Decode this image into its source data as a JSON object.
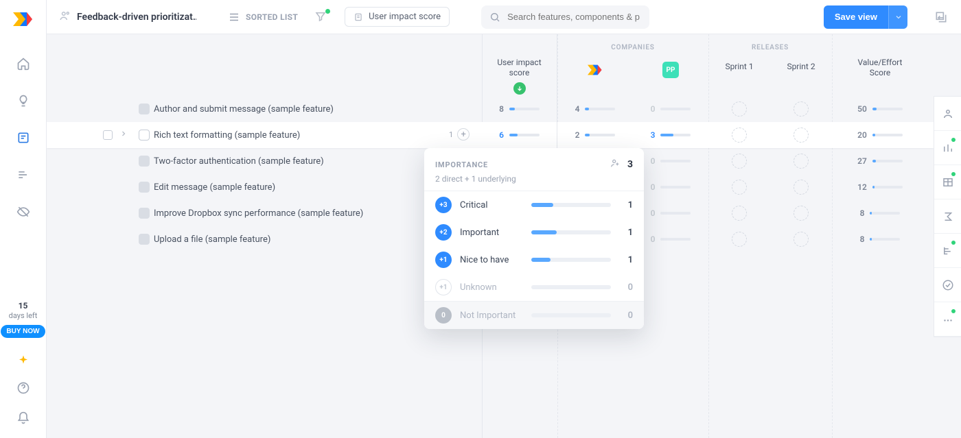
{
  "header": {
    "document_title": "Feedback-driven prioritizat…",
    "sorted_label": "SORTED LIST",
    "chip_label": "User impact score",
    "search_placeholder": "Search features, components & products…",
    "save_label": "Save view"
  },
  "trial": {
    "days": "15",
    "days_label": "days left",
    "buy_label": "BUY NOW"
  },
  "columns": {
    "user_impact": "User impact\nscore",
    "group_companies": "COMPANIES",
    "group_releases": "RELEASES",
    "release1": "Sprint 1",
    "release2": "Sprint 2",
    "value_effort": "Value/Effort\nScore",
    "company2_badge": "PP"
  },
  "rows": [
    {
      "name": "Author and submit message (sample feature)",
      "uis": "8",
      "uis_pct": 18,
      "c1": "4",
      "c1_pct": 12,
      "c2": "0",
      "c2_pct": 0,
      "ve": "50",
      "ve_pct": 14
    },
    {
      "name": "Rich text formatting (sample feature)",
      "hover": true,
      "count": "1",
      "uis": "6",
      "uis_pct": 28,
      "uis_blue": true,
      "c1": "2",
      "c1_pct": 16,
      "c2": "3",
      "c2_pct": 42,
      "ve": "20",
      "ve_pct": 10
    },
    {
      "name": "Two-factor authentication (sample feature)",
      "c2": "0",
      "ve": "27",
      "ve_pct": 12
    },
    {
      "name": "Edit message (sample feature)",
      "c2": "0",
      "ve": "12",
      "ve_pct": 8
    },
    {
      "name": "Improve Dropbox sync performance (sample feature)",
      "c2": "0",
      "ve": "8",
      "ve_pct": 6
    },
    {
      "name": "Upload a file (sample feature)",
      "c2": "0",
      "ve": "8",
      "ve_pct": 6
    }
  ],
  "popover": {
    "title": "IMPORTANCE",
    "total": "3",
    "subtitle": "2 direct + 1 underlying",
    "items": [
      {
        "pill": "+3",
        "pill_style": "b",
        "label": "Critical",
        "pct": 28,
        "value": "1"
      },
      {
        "pill": "+2",
        "pill_style": "b",
        "label": "Important",
        "pct": 32,
        "value": "1"
      },
      {
        "pill": "+1",
        "pill_style": "b",
        "label": "Nice to have",
        "pct": 24,
        "value": "1"
      },
      {
        "pill": "+1",
        "pill_style": "o",
        "label": "Unknown",
        "pct": 0,
        "value": "0",
        "muted": true
      }
    ],
    "footer": {
      "pill": "0",
      "pill_style": "g",
      "label": "Not Important",
      "pct": 0,
      "value": "0",
      "muted": true
    }
  }
}
